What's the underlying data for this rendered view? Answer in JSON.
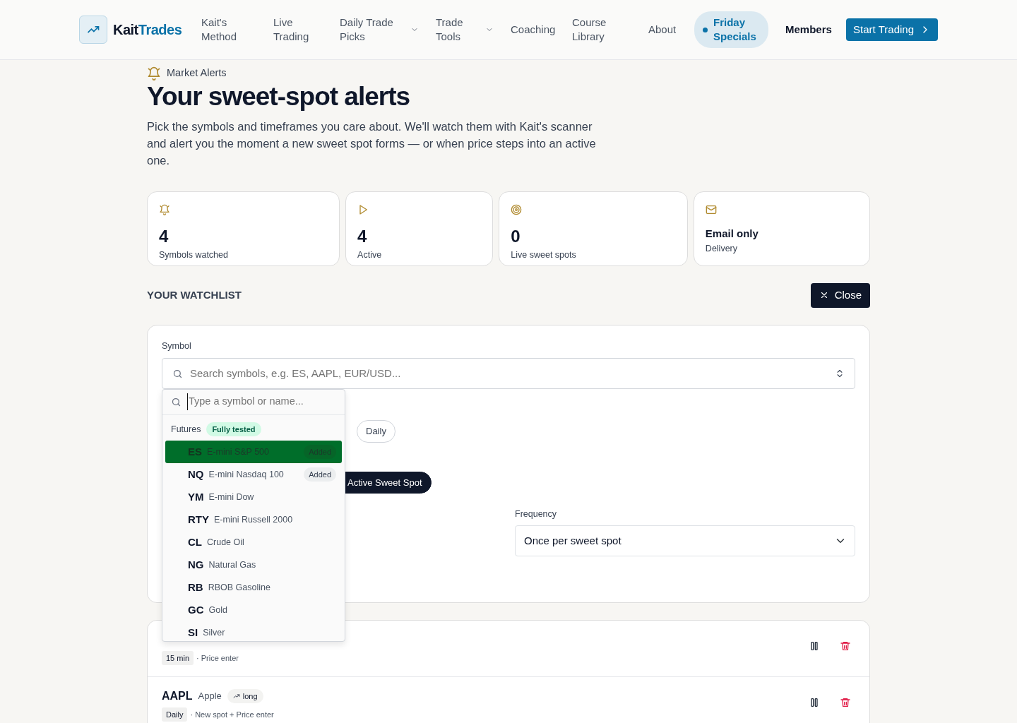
{
  "nav": {
    "brand_a": "Kait",
    "brand_b": "Trades",
    "items": [
      {
        "label": "Kait's Method",
        "dropdown": false
      },
      {
        "label": "Live Trading",
        "dropdown": false
      },
      {
        "label": "Daily Trade Picks",
        "dropdown": true
      },
      {
        "label": "Trade Tools",
        "dropdown": true
      },
      {
        "label": "Coaching",
        "dropdown": false
      },
      {
        "label": "Course Library",
        "dropdown": false
      },
      {
        "label": "About",
        "dropdown": false
      }
    ],
    "special": "Friday Specials",
    "members": "Members",
    "cta": "Start Trading"
  },
  "header": {
    "eyebrow": "Market Alerts",
    "title": "Your sweet-spot alerts",
    "lead": "Pick the symbols and timeframes you care about. We'll watch them with Kait's scanner and alert you the moment a new sweet spot forms — or when price steps into an active one."
  },
  "stats": [
    {
      "kind": "symbols",
      "value": "4",
      "label": "Symbols watched"
    },
    {
      "kind": "active",
      "value": "4",
      "label": "Active"
    },
    {
      "kind": "spots",
      "value": "0",
      "label": "Live sweet spots"
    },
    {
      "kind": "delivery",
      "value": "Email only",
      "label": "Delivery"
    }
  ],
  "watchlist": {
    "heading": "YOUR WATCHLIST",
    "close": "Close"
  },
  "form": {
    "symbol_label": "Symbol",
    "symbol_placeholder": "Search symbols, e.g. ES, AAPL, EUR/USD...",
    "timeframes": [
      {
        "label": "Daily",
        "selected": false
      }
    ],
    "alert_types": [
      {
        "label": "Active Sweet Spot",
        "selected": true
      }
    ],
    "frequency_label": "Frequency",
    "frequency_value": "Once per sweet spot"
  },
  "dropdown": {
    "placeholder": "Type a symbol or name...",
    "group": "Futures",
    "group_badge": "Fully tested",
    "items": [
      {
        "symbol": "ES",
        "name": "E-mini S&P 500",
        "added": true,
        "added_label": "Added",
        "selected": true
      },
      {
        "symbol": "NQ",
        "name": "E-mini Nasdaq 100",
        "added": true,
        "added_label": "Added",
        "selected": false
      },
      {
        "symbol": "YM",
        "name": "E-mini Dow",
        "added": false,
        "selected": false
      },
      {
        "symbol": "RTY",
        "name": "E-mini Russell 2000",
        "added": false,
        "selected": false
      },
      {
        "symbol": "CL",
        "name": "Crude Oil",
        "added": false,
        "selected": false
      },
      {
        "symbol": "NG",
        "name": "Natural Gas",
        "added": false,
        "selected": false
      },
      {
        "symbol": "RB",
        "name": "RBOB Gasoline",
        "added": false,
        "selected": false
      },
      {
        "symbol": "GC",
        "name": "Gold",
        "added": false,
        "selected": false
      },
      {
        "symbol": "SI",
        "name": "Silver",
        "added": false,
        "selected": false
      }
    ]
  },
  "rows": [
    {
      "timeframe": "15 min",
      "detail": "· Price enter"
    },
    {
      "symbol": "AAPL",
      "name": "Apple",
      "trend": "long",
      "timeframe": "Daily",
      "detail": "· New spot + Price enter"
    }
  ]
}
